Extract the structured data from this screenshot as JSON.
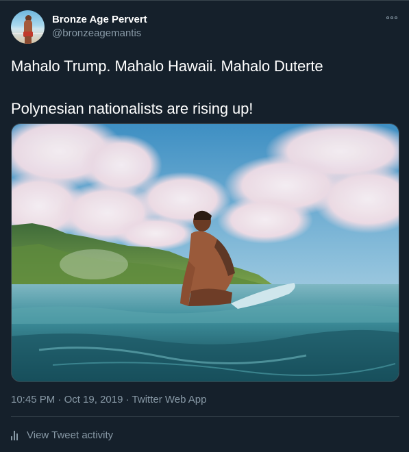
{
  "author": {
    "display_name": "Bronze Age Pervert",
    "handle": "@bronzeagemantis",
    "avatar_icon": "profile-avatar"
  },
  "menu": {
    "icon": "more-options-icon"
  },
  "tweet": {
    "text_line_1": "Mahalo Trump. Mahalo Hawaii. Mahalo Duterte",
    "text_line_2": "Polynesian nationalists are rising up!"
  },
  "meta": {
    "time": "10:45 PM",
    "separator_1": " · ",
    "date": "Oct 19, 2019",
    "separator_2": " · ",
    "source": "Twitter Web App"
  },
  "activity": {
    "icon": "bar-chart-icon",
    "label": "View Tweet activity"
  },
  "colors": {
    "background": "#15202b",
    "secondary_text": "#8899a6",
    "border": "#38444d"
  }
}
